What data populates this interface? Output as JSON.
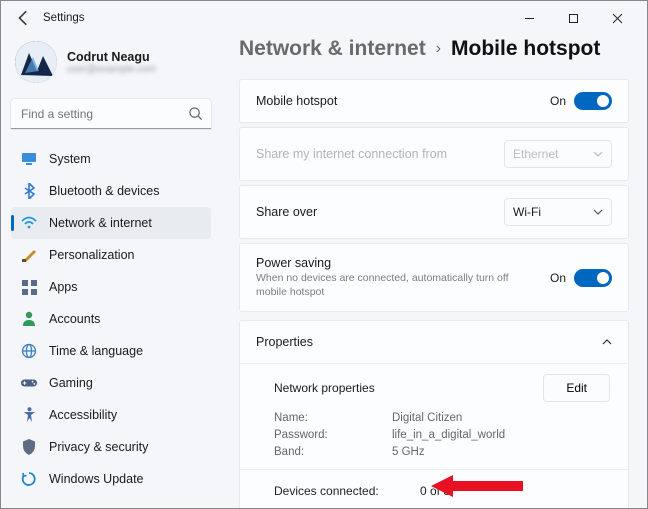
{
  "window": {
    "title": "Settings"
  },
  "user": {
    "name": "Codrut Neagu",
    "email": "user@example.com"
  },
  "search": {
    "placeholder": "Find a setting"
  },
  "sidebar": {
    "items": [
      {
        "label": "System",
        "icon": "system",
        "color": "#3a8ddb"
      },
      {
        "label": "Bluetooth & devices",
        "icon": "bluetooth",
        "color": "#2f7bd1"
      },
      {
        "label": "Network & internet",
        "icon": "wifi",
        "color": "#1e9ad6"
      },
      {
        "label": "Personalization",
        "icon": "brush",
        "color": "#d08728"
      },
      {
        "label": "Apps",
        "icon": "apps",
        "color": "#5b6b8c"
      },
      {
        "label": "Accounts",
        "icon": "person",
        "color": "#2f9a5c"
      },
      {
        "label": "Time & language",
        "icon": "globe",
        "color": "#3a7ec2"
      },
      {
        "label": "Gaming",
        "icon": "gaming",
        "color": "#4a5d82"
      },
      {
        "label": "Accessibility",
        "icon": "accessibility",
        "color": "#4b6aa8"
      },
      {
        "label": "Privacy & security",
        "icon": "shield",
        "color": "#5e6c84"
      },
      {
        "label": "Windows Update",
        "icon": "update",
        "color": "#1e87c7"
      }
    ],
    "activeIndex": 2
  },
  "breadcrumb": {
    "parent": "Network & internet",
    "page": "Mobile hotspot"
  },
  "panels": {
    "hotspot": {
      "label": "Mobile hotspot",
      "state": "On"
    },
    "sharefrom": {
      "label": "Share my internet connection from",
      "value": "Ethernet"
    },
    "shareover": {
      "label": "Share over",
      "value": "Wi-Fi"
    },
    "powersave": {
      "label": "Power saving",
      "sub": "When no devices are connected, automatically turn off mobile hotspot",
      "state": "On"
    }
  },
  "properties": {
    "header": "Properties",
    "section": "Network properties",
    "edit": "Edit",
    "rows": {
      "name": {
        "k": "Name:",
        "v": "Digital Citizen"
      },
      "password": {
        "k": "Password:",
        "v": "life_in_a_digital_world"
      },
      "band": {
        "k": "Band:",
        "v": "5 GHz"
      }
    },
    "devices": {
      "k": "Devices connected:",
      "v": "0 of 8"
    }
  }
}
